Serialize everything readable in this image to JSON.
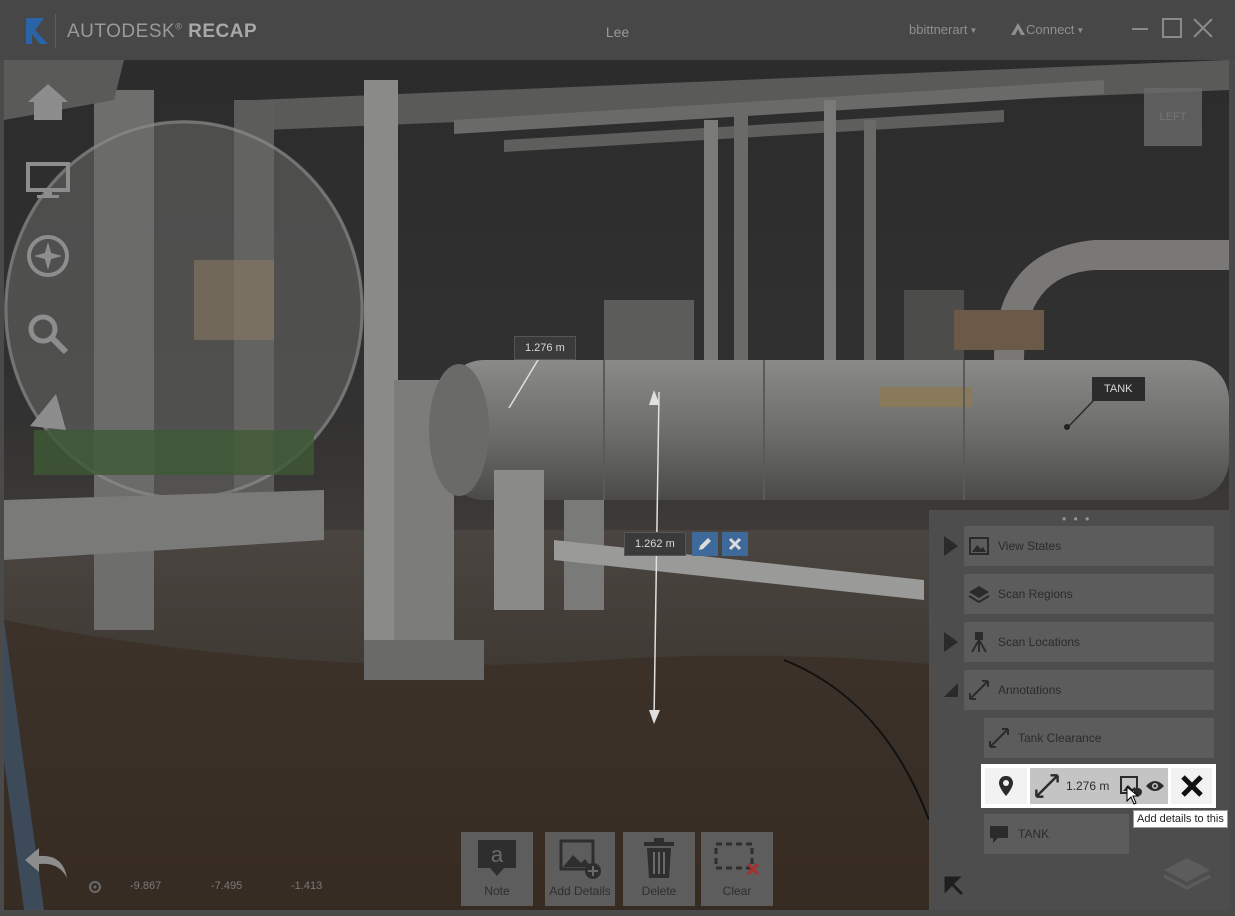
{
  "app": {
    "brand_light": "AUTODESK",
    "brand_bold": "RECAP",
    "document_title": "Lee",
    "user_name": "bbittnerart",
    "connect_label": "Connect"
  },
  "viewport": {
    "viewcube_face": "LEFT",
    "measurements": [
      {
        "label": "1.276 m"
      },
      {
        "label": "1.262 m"
      }
    ],
    "tank_tag": "TANK",
    "coords": {
      "x": "-9.867",
      "y": "-7.495",
      "z": "-1.413"
    }
  },
  "toolbar": {
    "note_label": "Note",
    "note_glyph": "a",
    "add_details_label": "Add Details",
    "delete_label": "Delete",
    "clear_label": "Clear"
  },
  "panel": {
    "view_states": "View States",
    "scan_regions": "Scan Regions",
    "scan_locations": "Scan Locations",
    "annotations": "Annotations",
    "tank_clearance": "Tank Clearance",
    "selected_measurement": "1.276 m",
    "tank_note": "TANK",
    "tooltip": "Add details to this"
  },
  "colors": {
    "accent_blue": "#3d6a9a",
    "logo_blue": "#1f5fa8",
    "panel_bg": "#4d4d4d",
    "row_bg": "#5c5c5c"
  }
}
